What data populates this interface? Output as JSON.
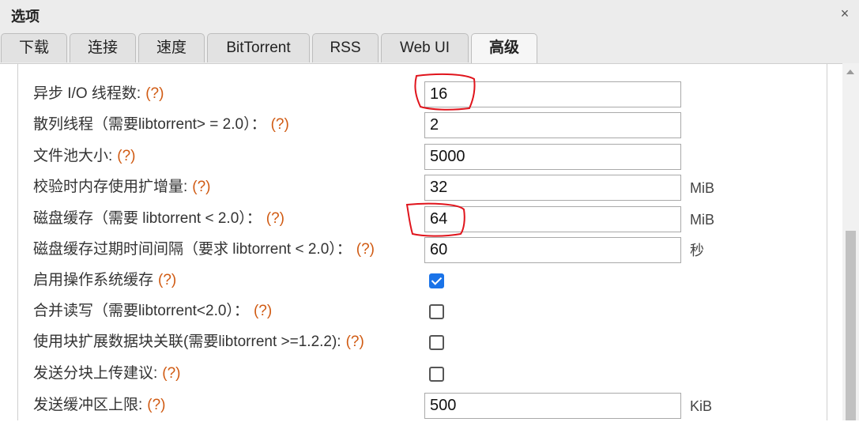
{
  "window": {
    "title": "选项",
    "close_glyph": "×"
  },
  "tabs": [
    {
      "label": "下载",
      "active": false
    },
    {
      "label": "连接",
      "active": false
    },
    {
      "label": "速度",
      "active": false
    },
    {
      "label": "BitTorrent",
      "active": false
    },
    {
      "label": "RSS",
      "active": false
    },
    {
      "label": "Web UI",
      "active": false
    },
    {
      "label": "高级",
      "active": true
    }
  ],
  "help_text": "(?)",
  "rows": [
    {
      "label": "异步 I/O 线程数:",
      "type": "input",
      "value": "16",
      "unit": ""
    },
    {
      "label": "散列线程（需要libtorrent> = 2.0）：",
      "type": "input",
      "value": "2",
      "unit": ""
    },
    {
      "label": "文件池大小:",
      "type": "input",
      "value": "5000",
      "unit": ""
    },
    {
      "label": "校验时内存使用扩增量:",
      "type": "input",
      "value": "32",
      "unit": "MiB"
    },
    {
      "label": "磁盘缓存（需要 libtorrent < 2.0）：",
      "type": "input",
      "value": "64",
      "unit": "MiB"
    },
    {
      "label": "磁盘缓存过期时间间隔（要求 libtorrent < 2.0）：",
      "type": "input",
      "value": "60",
      "unit": "秒"
    },
    {
      "label": "启用操作系统缓存",
      "type": "checkbox",
      "checked": true
    },
    {
      "label": "合并读写（需要libtorrent<2.0）：",
      "type": "checkbox",
      "checked": false
    },
    {
      "label": "使用块扩展数据块关联(需要libtorrent >=1.2.2):",
      "type": "checkbox",
      "checked": false
    },
    {
      "label": "发送分块上传建议:",
      "type": "checkbox",
      "checked": false
    },
    {
      "label": "发送缓冲区上限:",
      "type": "input",
      "value": "500",
      "unit": "KiB"
    }
  ],
  "colors": {
    "help": "#d05a12",
    "annotation": "#e0141c",
    "checkbox_checked": "#1a73e8"
  }
}
